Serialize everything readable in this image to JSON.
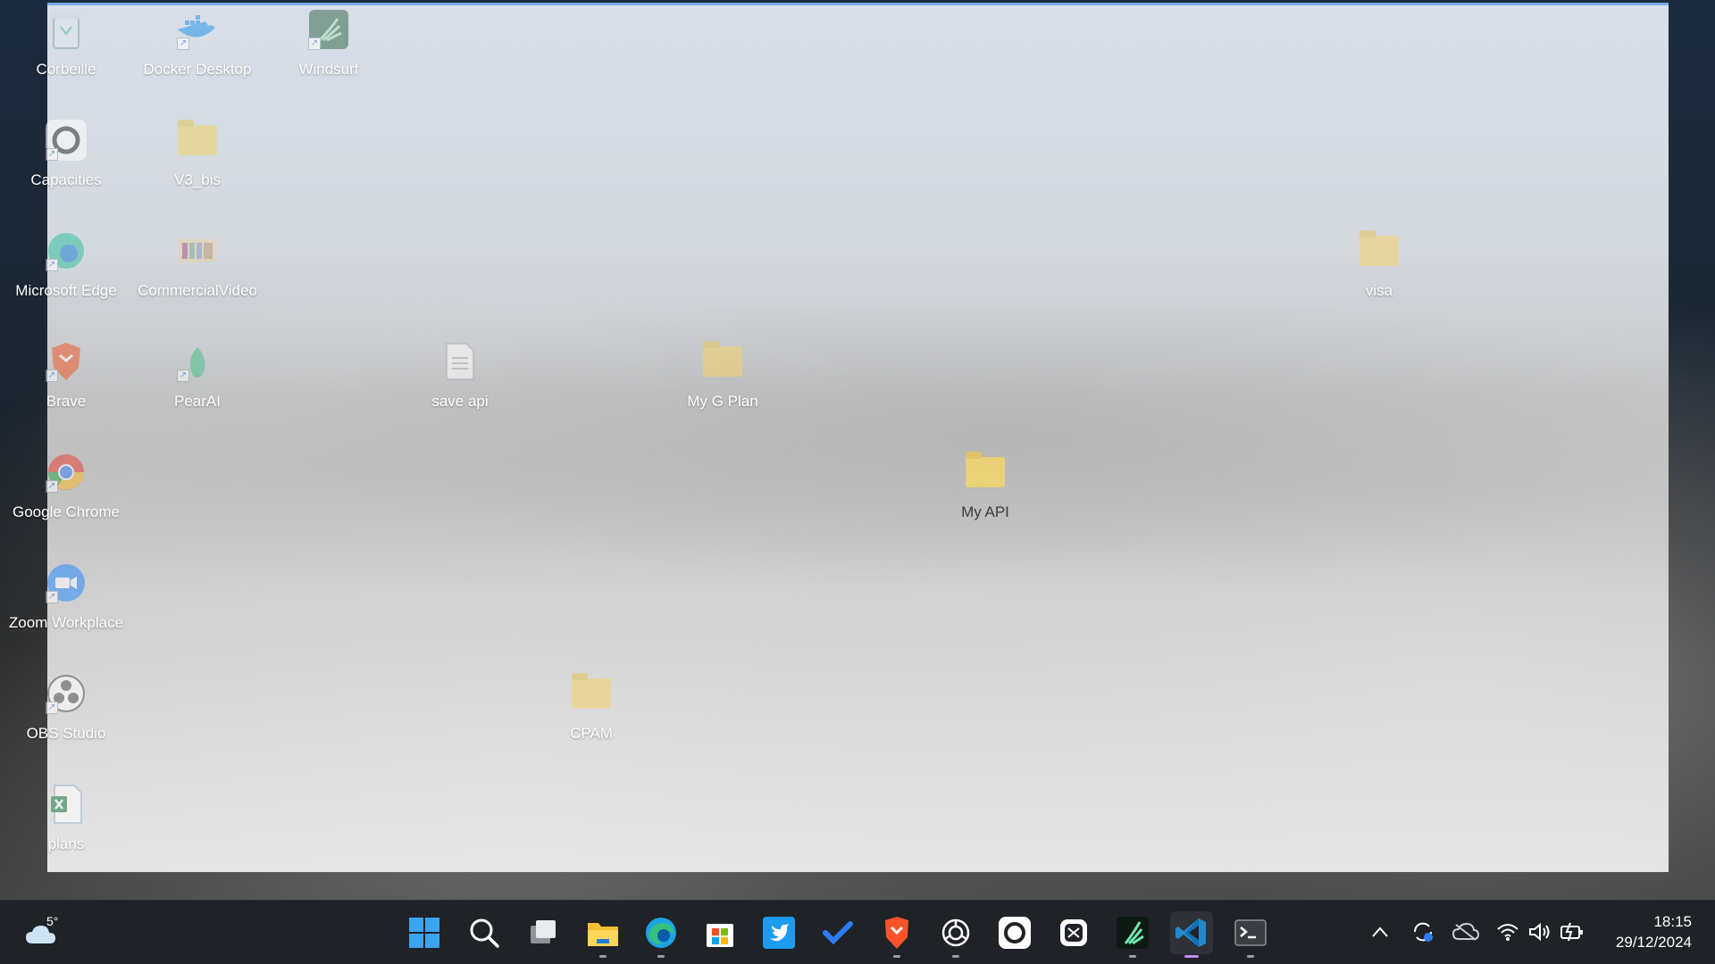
{
  "desktop": {
    "icons": [
      {
        "label": "Corbeille"
      },
      {
        "label": "Docker Desktop"
      },
      {
        "label": "Windsurf"
      },
      {
        "label": "Capacities"
      },
      {
        "label": "V3_bis"
      },
      {
        "label": "Microsoft Edge"
      },
      {
        "label": "CommercialVideo"
      },
      {
        "label": "visa"
      },
      {
        "label": "Brave"
      },
      {
        "label": "PearAI"
      },
      {
        "label": "save api"
      },
      {
        "label": "My G Plan"
      },
      {
        "label": "Google Chrome"
      },
      {
        "label": "My API"
      },
      {
        "label": "Zoom Workplace"
      },
      {
        "label": "OBS Studio"
      },
      {
        "label": "CPAM"
      },
      {
        "label": "plans"
      }
    ]
  },
  "taskbar": {
    "weather": {
      "temp": "5°",
      "icon": "cloud-icon"
    },
    "apps": [
      {
        "name": "start-icon"
      },
      {
        "name": "search-icon"
      },
      {
        "name": "task-view-icon"
      },
      {
        "name": "file-explorer-icon"
      },
      {
        "name": "edge-icon"
      },
      {
        "name": "microsoft-store-icon"
      },
      {
        "name": "twitter-icon"
      },
      {
        "name": "todo-icon"
      },
      {
        "name": "brave-icon"
      },
      {
        "name": "chatgpt-icon"
      },
      {
        "name": "capacities-icon"
      },
      {
        "name": "app-icon"
      },
      {
        "name": "windsurf-icon"
      },
      {
        "name": "vscode-icon"
      },
      {
        "name": "terminal-icon"
      }
    ],
    "clock": {
      "time": "18:15",
      "date": "29/12/2024"
    }
  },
  "colors": {
    "taskbar_bg": "#1f2227",
    "folder": "#f3d46b",
    "active_indicator": "#c48cf0",
    "window_border": "#7aa7e8"
  }
}
